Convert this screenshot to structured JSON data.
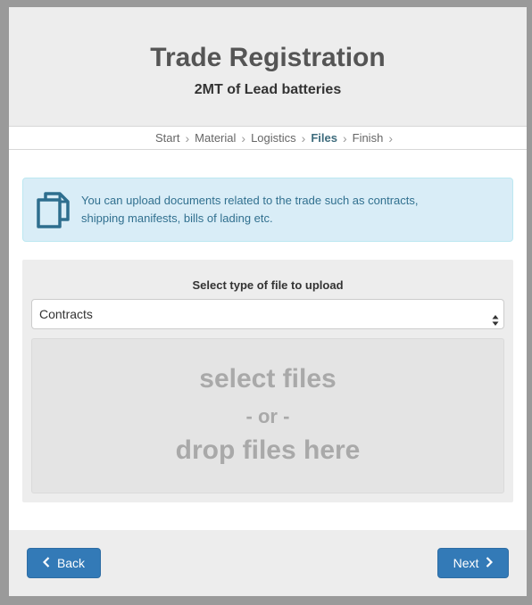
{
  "header": {
    "title": "Trade Registration",
    "subtitle": "2MT of Lead batteries"
  },
  "steps": [
    {
      "label": "Start",
      "active": false
    },
    {
      "label": "Material",
      "active": false
    },
    {
      "label": "Logistics",
      "active": false
    },
    {
      "label": "Files",
      "active": true
    },
    {
      "label": "Finish",
      "active": false
    }
  ],
  "alert": {
    "icon": "documents-copy-icon",
    "line1": "You can upload documents related to the trade such as contracts,",
    "line2": "shipping manifests, bills of lading etc."
  },
  "upload": {
    "label": "Select type of file to upload",
    "selected_type": "Contracts",
    "dropzone_line1": "select files",
    "dropzone_line2": "- or -",
    "dropzone_line3": "drop files here"
  },
  "footer": {
    "back_label": "Back",
    "next_label": "Next"
  },
  "colors": {
    "primary": "#337ab7",
    "info_bg": "#d9edf7",
    "info_text": "#31708f",
    "active_step": "#3d6b7c"
  }
}
